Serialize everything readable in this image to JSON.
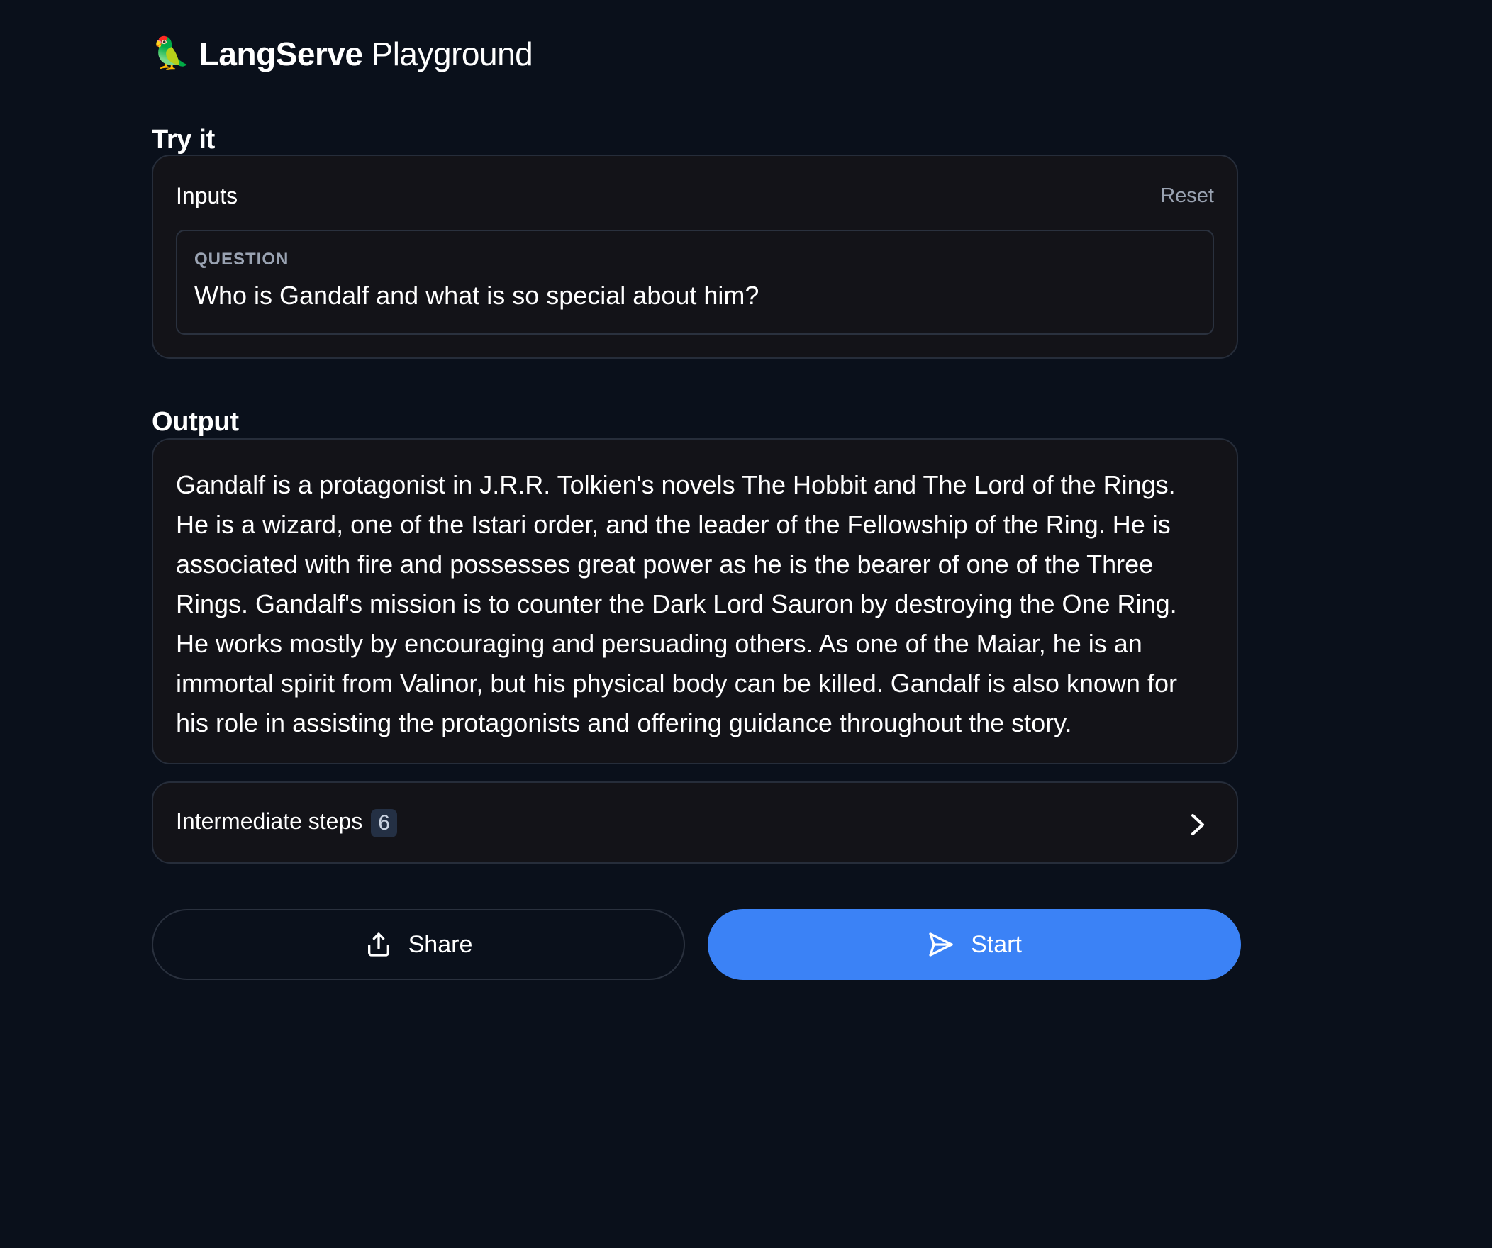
{
  "header": {
    "logo_emoji": "🦜",
    "brand_bold": "LangServe",
    "brand_light": "Playground"
  },
  "sections": {
    "try_it": "Try it",
    "output": "Output"
  },
  "inputs": {
    "label": "Inputs",
    "reset_label": "Reset",
    "field_label": "QUESTION",
    "field_value": "Who is Gandalf and what is so special about him?"
  },
  "output": {
    "text": "Gandalf is a protagonist in J.R.R. Tolkien's novels The Hobbit and The Lord of the Rings. He is a wizard, one of the Istari order, and the leader of the Fellowship of the Ring. He is associated with fire and possesses great power as he is the bearer of one of the Three Rings. Gandalf's mission is to counter the Dark Lord Sauron by destroying the One Ring. He works mostly by encouraging and persuading others. As one of the Maiar, he is an immortal spirit from Valinor, but his physical body can be killed. Gandalf is also known for his role in assisting the protagonists and offering guidance throughout the story."
  },
  "steps": {
    "label": "Intermediate steps",
    "count": "6"
  },
  "buttons": {
    "share_label": "Share",
    "start_label": "Start"
  },
  "colors": {
    "background": "#0a101b",
    "card": "#131318",
    "border": "#262d3a",
    "accent": "#3b82f6",
    "muted_text": "#9aa3b2"
  }
}
